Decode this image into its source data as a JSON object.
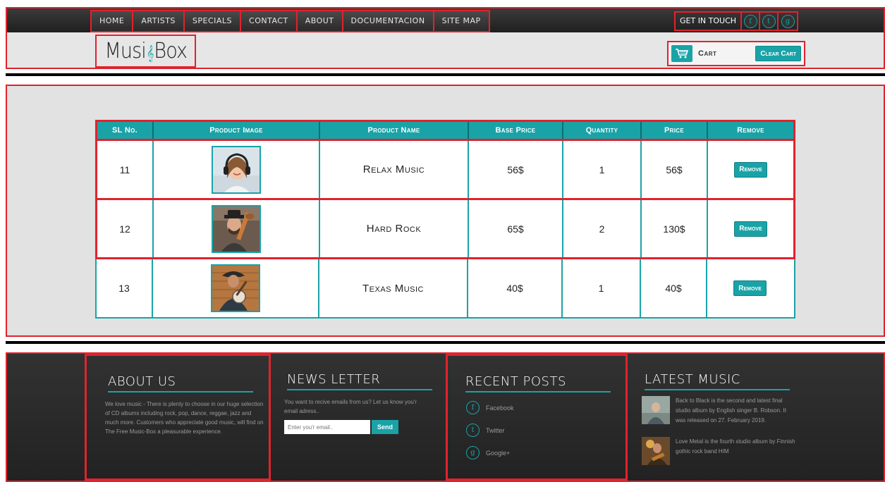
{
  "nav": {
    "items": [
      "Home",
      "Artists",
      "Specials",
      "Contact",
      "About",
      "Documentacion",
      "Site Map"
    ]
  },
  "get_in_touch": {
    "label": "Get in touch",
    "icons": [
      {
        "name": "facebook-icon",
        "glyph": "f"
      },
      {
        "name": "twitter-icon",
        "glyph": "t"
      },
      {
        "name": "google-plus-icon",
        "glyph": "g"
      }
    ]
  },
  "logo": {
    "left": "Musi",
    "clef": "𝄞",
    "right": "Box"
  },
  "cart": {
    "label": "Cart",
    "clear_label": "Clear Cart"
  },
  "table": {
    "headers": [
      "SL No.",
      "Product Image",
      "Product Name",
      "Base Price",
      "Quantity",
      "Price",
      "Remove"
    ],
    "rows": [
      {
        "sl": "11",
        "image": "woman-headphones",
        "name": "Relax Music",
        "base_price": "56$",
        "quantity": "1",
        "price": "56$",
        "remove": "Remove"
      },
      {
        "sl": "12",
        "image": "man-guitar",
        "name": "Hard Rock",
        "base_price": "65$",
        "quantity": "2",
        "price": "130$",
        "remove": "Remove"
      },
      {
        "sl": "13",
        "image": "man-banjo",
        "name": "Texas Music",
        "base_price": "40$",
        "quantity": "1",
        "price": "40$",
        "remove": "Remove"
      }
    ]
  },
  "footer": {
    "about": {
      "title": "About Us",
      "text": "We love music - There is plenty to choose in our huge selection of CD albums including rock, pop, dance, reggae, jazz and much more. Customers who appreciate good music, will find on The Free Music-Box a pleasurable experience."
    },
    "newsletter": {
      "title": "News Letter",
      "text": "You want to recive emails from us? Let us know you'r email adress..",
      "placeholder": "Enter you'r email..",
      "button": "Send"
    },
    "recent_posts": {
      "title": "Recent Posts",
      "items": [
        {
          "glyph": "f",
          "label": "Facebook"
        },
        {
          "glyph": "t",
          "label": "Twitter"
        },
        {
          "glyph": "g",
          "label": "Google+"
        }
      ]
    },
    "latest_music": {
      "title": "Latest Music",
      "items": [
        {
          "text": "Back to Black is the second and latest final studio album by English singer B. Robson. It was released on 27. February 2019."
        },
        {
          "text": "Love Metal is the fourth studio album by Finnish gothic rock band HIM"
        }
      ]
    }
  },
  "colors": {
    "accent": "#19a3a7",
    "highlight": "#e0232e",
    "dark": "#2a2a2a"
  }
}
